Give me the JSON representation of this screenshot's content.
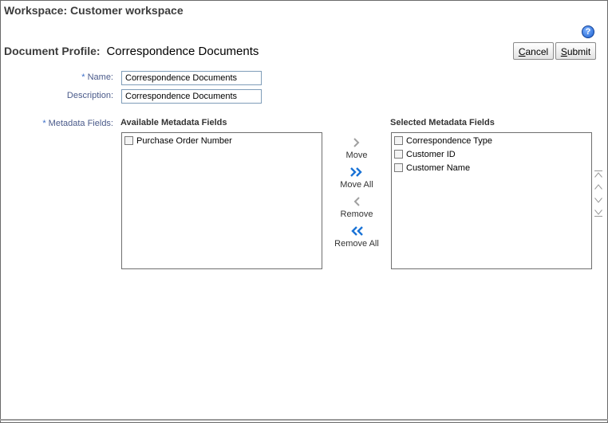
{
  "workspace": {
    "title": "Workspace: Customer workspace"
  },
  "help": {
    "label": "?"
  },
  "profile": {
    "label": "Document Profile:",
    "value": "Correspondence Documents"
  },
  "buttons": {
    "cancel": {
      "access_key": "C",
      "rest": "ancel"
    },
    "submit": {
      "access_key": "S",
      "rest": "ubmit"
    }
  },
  "form": {
    "name": {
      "required": "*",
      "label": "Name:",
      "value": "Correspondence Documents"
    },
    "description": {
      "label": "Description:",
      "value": "Correspondence Documents"
    },
    "metadata": {
      "required": "*",
      "label": "Metadata Fields:"
    }
  },
  "available": {
    "caption": "Available Metadata Fields",
    "items": [
      "Purchase Order Number"
    ]
  },
  "selected": {
    "caption": "Selected Metadata Fields",
    "items": [
      "Correspondence Type",
      "Customer ID",
      "Customer Name"
    ]
  },
  "shuttle": {
    "move": "Move",
    "move_all": "Move All",
    "remove": "Remove",
    "remove_all": "Remove All"
  },
  "colors": {
    "accent_blue": "#1a73d6",
    "arrow_gray": "#a0a0a0",
    "label_blue": "#4a5a8a"
  },
  "icons": {
    "move": "chevron-right-icon",
    "move_all": "double-chevron-right-icon",
    "remove": "chevron-left-icon",
    "remove_all": "double-chevron-left-icon",
    "top": "move-to-top-icon",
    "up": "move-up-icon",
    "down": "move-down-icon",
    "bottom": "move-to-bottom-icon",
    "help": "help-icon"
  }
}
